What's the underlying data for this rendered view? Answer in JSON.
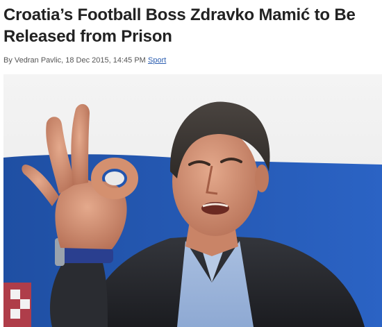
{
  "article": {
    "headline": "Croatia’s Football Boss Zdravko Mamić to Be Released from Prison",
    "byline": "By Vedran Pavlic, 18 Dec 2015, 14:45 PM",
    "category": "Sport"
  },
  "photo": {
    "subject_icon": "person-photo-icon"
  },
  "colors": {
    "headline": "#222222",
    "byline": "#555555",
    "link": "#2a5db0",
    "backdrop_blue": "#1f4fa3"
  }
}
